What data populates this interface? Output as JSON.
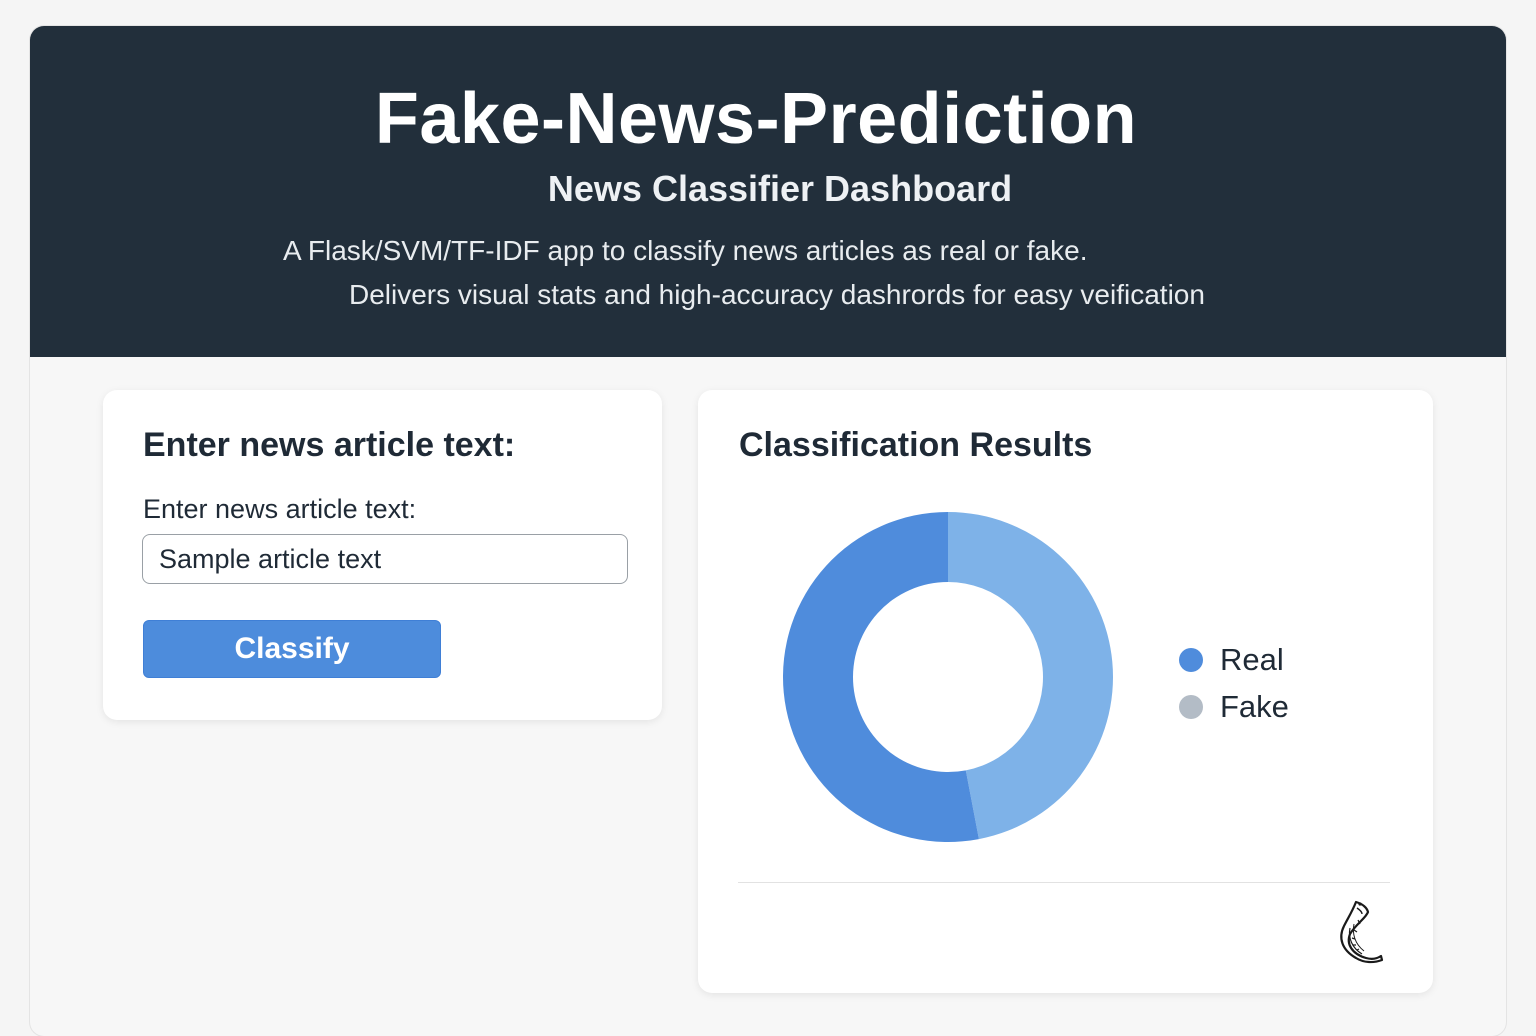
{
  "header": {
    "title": "Fake-News-Prediction",
    "subtitle": "News Classifier Dashboard",
    "description_line1": "A Flask/SVM/TF-IDF app to classify news articles as real or fake.",
    "description_line2": "Delivers visual stats and high-accuracy dashrords for easy veification"
  },
  "input_card": {
    "title": "Enter news article text:",
    "field_label": "Enter news article text:",
    "field_value": "Sample article text",
    "button_label": "Classify"
  },
  "results_card": {
    "title": "Classification Results",
    "footer_icon": "flask-horn-icon"
  },
  "colors": {
    "header_bg": "#222f3b",
    "accent": "#4d8cdc",
    "real": "#4f8cdc",
    "fake_segment": "#7eb2e8",
    "fake_legend": "#b3bcc6"
  },
  "chart_data": {
    "type": "pie",
    "style": "donut",
    "categories": [
      "Real",
      "Fake"
    ],
    "values": [
      53,
      47
    ],
    "legend": [
      "Real",
      "Fake"
    ],
    "legend_position": "right",
    "title": ""
  }
}
